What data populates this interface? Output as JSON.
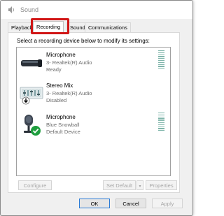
{
  "window": {
    "title": "Sound"
  },
  "tabs": [
    "Playback",
    "Recording",
    "Sounds",
    "Communications"
  ],
  "active_tab": "Recording",
  "instruction": "Select a recording device below to modify its settings:",
  "devices": [
    {
      "name": "Microphone",
      "driver": "3- Realtek(R) Audio",
      "status": "Ready",
      "icon": "microphone-bar-icon"
    },
    {
      "name": "Stereo Mix",
      "driver": "3- Realtek(R) Audio",
      "status": "Disabled",
      "icon": "stereo-mix-board-icon"
    },
    {
      "name": "Microphone",
      "driver": "Blue Snowball",
      "status": "Default Device",
      "icon": "usb-microphone-icon"
    }
  ],
  "buttons": {
    "configure": "Configure",
    "set_default": "Set Default",
    "properties": "Properties",
    "ok": "OK",
    "cancel": "Cancel",
    "apply": "Apply"
  },
  "colors": {
    "highlight": "#d11616",
    "meter": "#7fb5aa",
    "default_check": "#1e9e3e",
    "disabled_arrow": "#000000"
  }
}
